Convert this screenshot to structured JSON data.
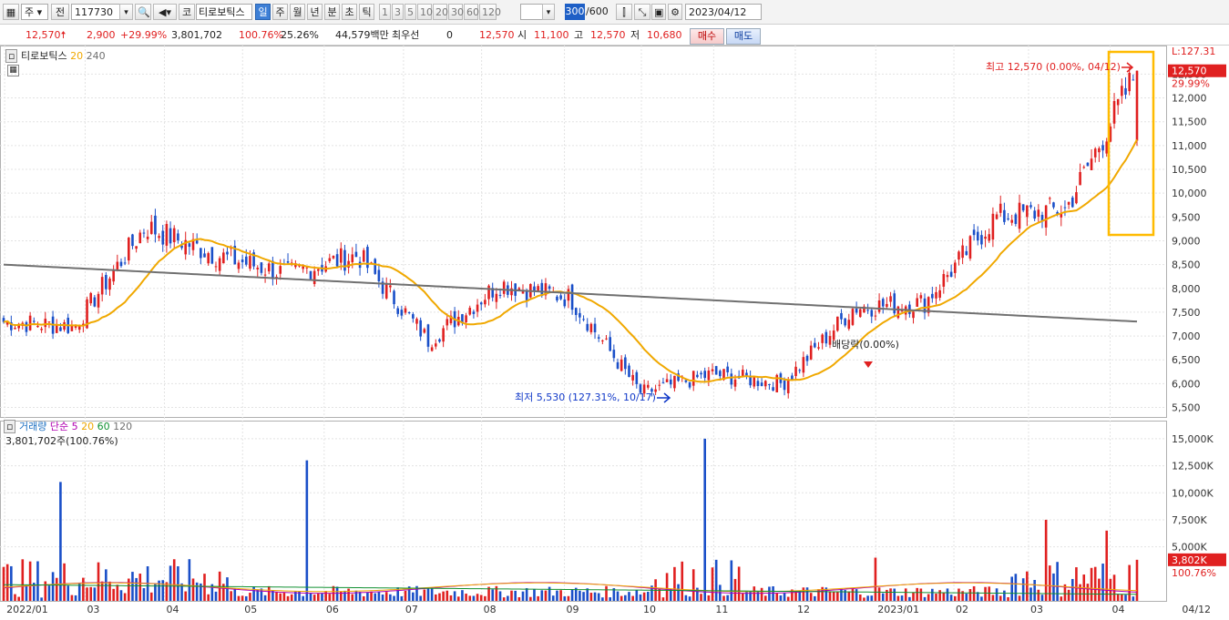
{
  "toolbar": {
    "market_label": "주",
    "prev_label": "전",
    "stock_code": "117730",
    "stock_name": "티로보틱스",
    "code_prefix": "코",
    "periods": [
      "일",
      "주",
      "월",
      "년",
      "분",
      "초",
      "틱"
    ],
    "active_period": "일",
    "intervals": [
      "1",
      "3",
      "5",
      "10",
      "20",
      "30",
      "60",
      "120"
    ],
    "count_value": "300",
    "count_max": "/600",
    "date": "2023/04/12"
  },
  "quote": {
    "price": "12,570",
    "change": "2,900",
    "change_pct": "+29.99%",
    "volume": "3,801,702",
    "vol_ratio": "100.76%",
    "turnover": "25.26%",
    "amount": "44,579백만",
    "priority_label": "최우선",
    "priority_value": "0",
    "priority_price": "12,570",
    "open_label": "시",
    "open": "11,100",
    "high_label": "고",
    "high": "12,570",
    "low_label": "저",
    "low": "10,680",
    "buy_label": "매수",
    "sell_label": "매도"
  },
  "price_panel": {
    "legend_name": "티로보틱스",
    "ma_short": "20",
    "ma_long": "240",
    "corner_label": "L:127.31",
    "current_tag": "12,570",
    "current_pct": "29.99%",
    "high_annotation": "최고 12,570 (0.00%, 04/12)",
    "low_annotation": "최저 5,530 (127.31%, 10/17)",
    "event_annotation": "배당락(0.00%)"
  },
  "volume_panel": {
    "legend_title": "거래량",
    "legend_simple": "단순",
    "ma_labels": [
      "5",
      "20",
      "60",
      "120"
    ],
    "info_line": "3,801,702주(100.76%)",
    "current_tag": "3,802K",
    "current_pct": "100.76%"
  },
  "chart_data": {
    "type": "candlestick",
    "title": "티로보틱스",
    "price_axis": {
      "ticks": [
        "12,500",
        "12,000",
        "11,500",
        "11,000",
        "10,500",
        "10,000",
        "9,500",
        "9,000",
        "8,500",
        "8,000",
        "7,500",
        "7,000",
        "6,500",
        "6,000",
        "5,500"
      ],
      "ylim": [
        5300,
        13100
      ]
    },
    "volume_axis": {
      "ticks": [
        "15,000K",
        "12,500K",
        "10,000K",
        "7,500K",
        "5,000K"
      ],
      "ylim": [
        0,
        16000
      ]
    },
    "x_axis_labels": [
      "2022/01",
      "03",
      "04",
      "05",
      "06",
      "07",
      "08",
      "09",
      "10",
      "11",
      "12",
      "2023/01",
      "02",
      "03",
      "04",
      "04/12"
    ],
    "key_levels": [
      {
        "label": "최고",
        "value": 12570,
        "date": "04/12"
      },
      {
        "label": "최저",
        "value": 5530,
        "date": "10/17"
      }
    ],
    "price_path": [
      {
        "month": "2022/01",
        "close": 7300
      },
      {
        "month": "02",
        "close": 7200
      },
      {
        "month": "03",
        "close": 9300
      },
      {
        "month": "04",
        "close": 8700
      },
      {
        "month": "05",
        "close": 8300
      },
      {
        "month": "06",
        "close": 8700
      },
      {
        "month": "07",
        "close": 6900
      },
      {
        "month": "08",
        "close": 8100
      },
      {
        "month": "09",
        "close": 7800
      },
      {
        "month": "10",
        "close": 5800
      },
      {
        "month": "11",
        "close": 6200
      },
      {
        "month": "12",
        "close": 6000
      },
      {
        "month": "2023/01",
        "close": 7600
      },
      {
        "month": "02",
        "close": 7700
      },
      {
        "month": "03",
        "close": 9500
      },
      {
        "month": "04",
        "close": 9670
      },
      {
        "month": "04/12",
        "close": 12570
      }
    ],
    "volume_peaks_k": [
      {
        "month": "2022/01",
        "value": 11000
      },
      {
        "month": "02",
        "value": 13000
      },
      {
        "month": "06",
        "value": 15000
      },
      {
        "month": "08",
        "value": 4000
      },
      {
        "month": "2023/01",
        "value": 2500
      },
      {
        "month": "03",
        "value": 7500
      },
      {
        "month": "04/12",
        "value": 3802
      }
    ],
    "grid": true,
    "colors": {
      "up": "#e02020",
      "down": "#1a4fc8",
      "ma20": "#f0a800",
      "ma240": "#707070",
      "highlight": "#ffbb00"
    }
  }
}
